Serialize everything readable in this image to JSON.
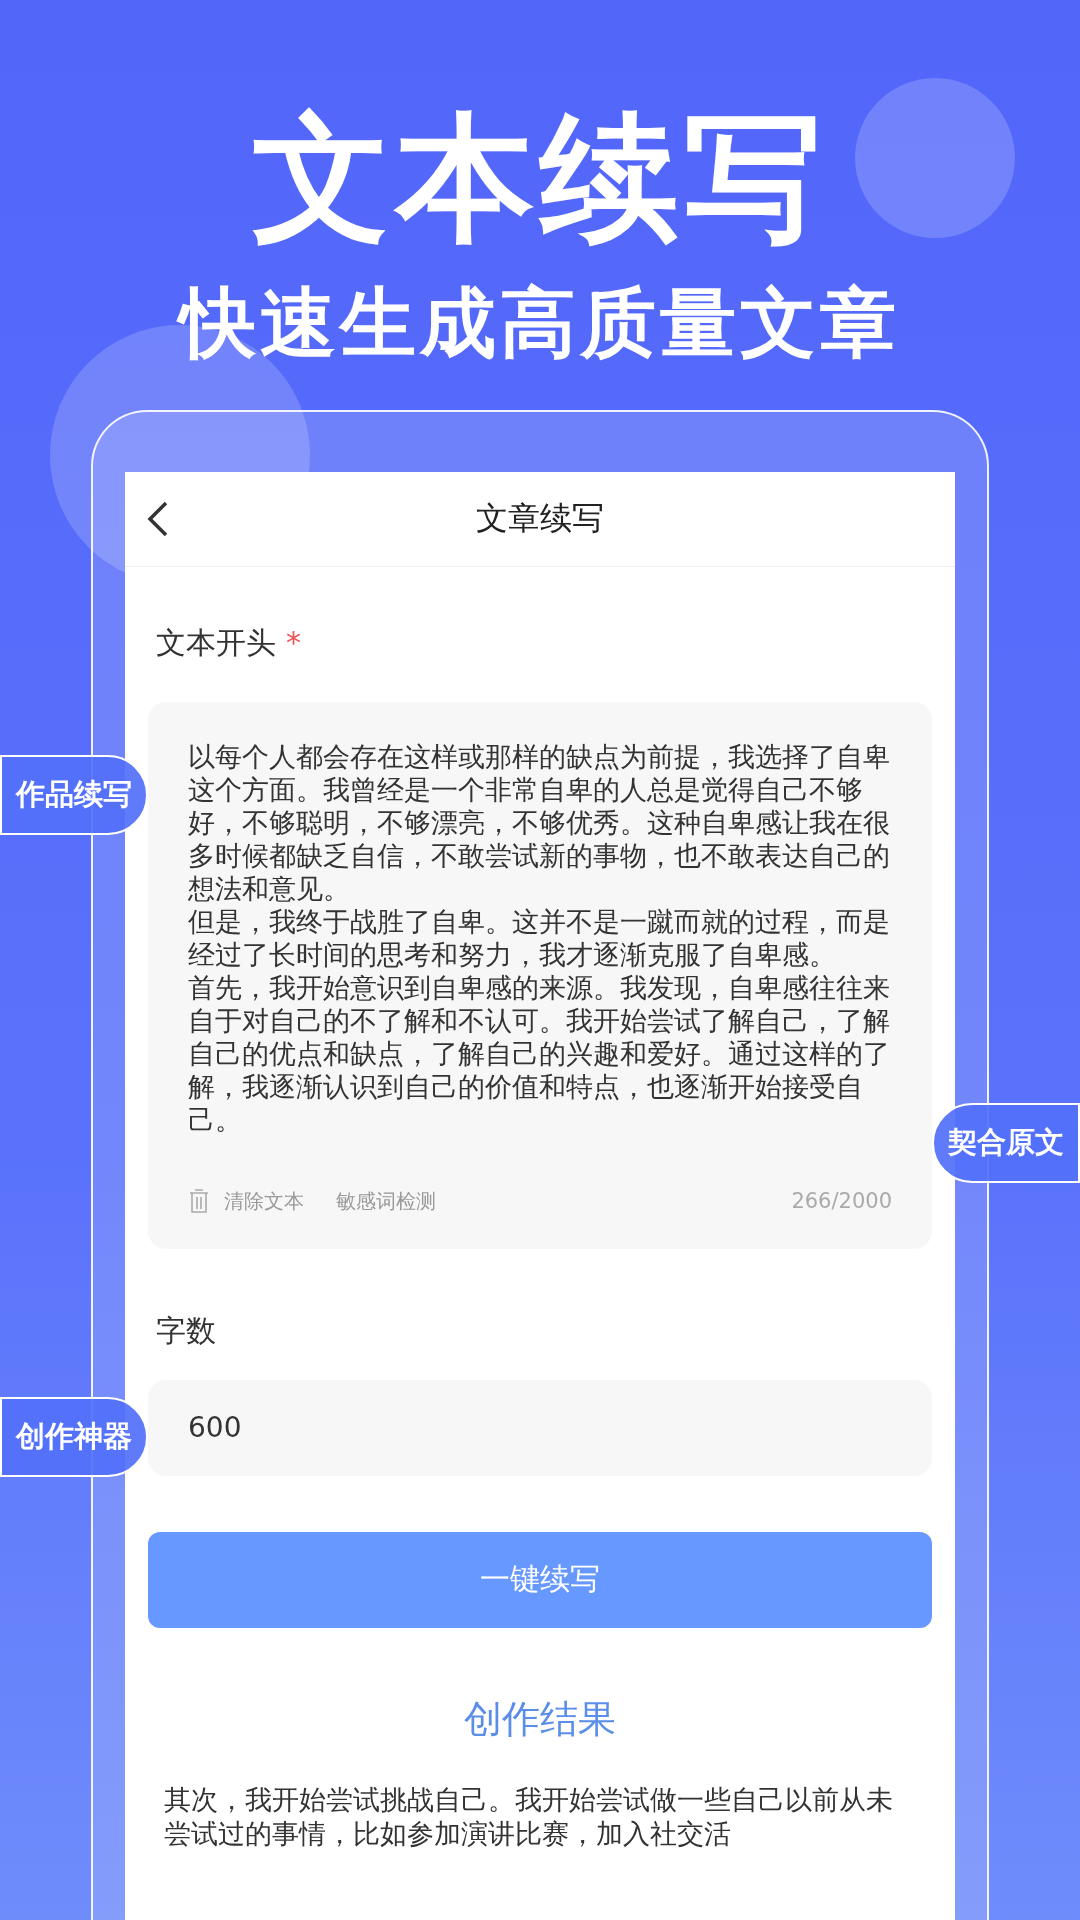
{
  "headline": "文本续写",
  "subheadline": "快速生成高质量文章",
  "screen": {
    "title": "文章续写",
    "opening": {
      "label": "文本开头",
      "required_mark": "*",
      "paragraphs": [
        "以每个人都会存在这样或那样的缺点为前提，我选择了自卑这个方面。我曾经是一个非常自卑的人总是觉得自己不够好，不够聪明，不够漂亮，不够优秀。这种自卑感让我在很多时候都缺乏自信，不敢尝试新的事物，也不敢表达自己的想法和意见。",
        "但是，我终于战胜了自卑。这并不是一蹴而就的过程，而是经过了长时间的思考和努力，我才逐渐克服了自卑感。",
        "首先，我开始意识到自卑感的来源。我发现，自卑感往往来自于对自己的不了解和不认可。我开始尝试了解自己，了解自己的优点和缺点，了解自己的兴趣和爱好。通过这样的了解，我逐渐认识到自己的价值和特点，也逐渐开始接受自己。"
      ],
      "actions": [
        "清除文本",
        "敏感词检测"
      ],
      "counter": "266/2000"
    },
    "word_count": {
      "label": "字数",
      "value": "600"
    },
    "submit": "一键续写",
    "result_title": "创作结果",
    "result_text": "其次，我开始尝试挑战自己。我开始尝试做一些自己以前从未尝试过的事情，比如参加演讲比赛，加入社交活"
  },
  "badges": [
    {
      "text": "作品续写",
      "kind": "left"
    },
    {
      "text": "契合原文",
      "kind": "right"
    },
    {
      "text": "创作神器",
      "kind": "left"
    }
  ]
}
